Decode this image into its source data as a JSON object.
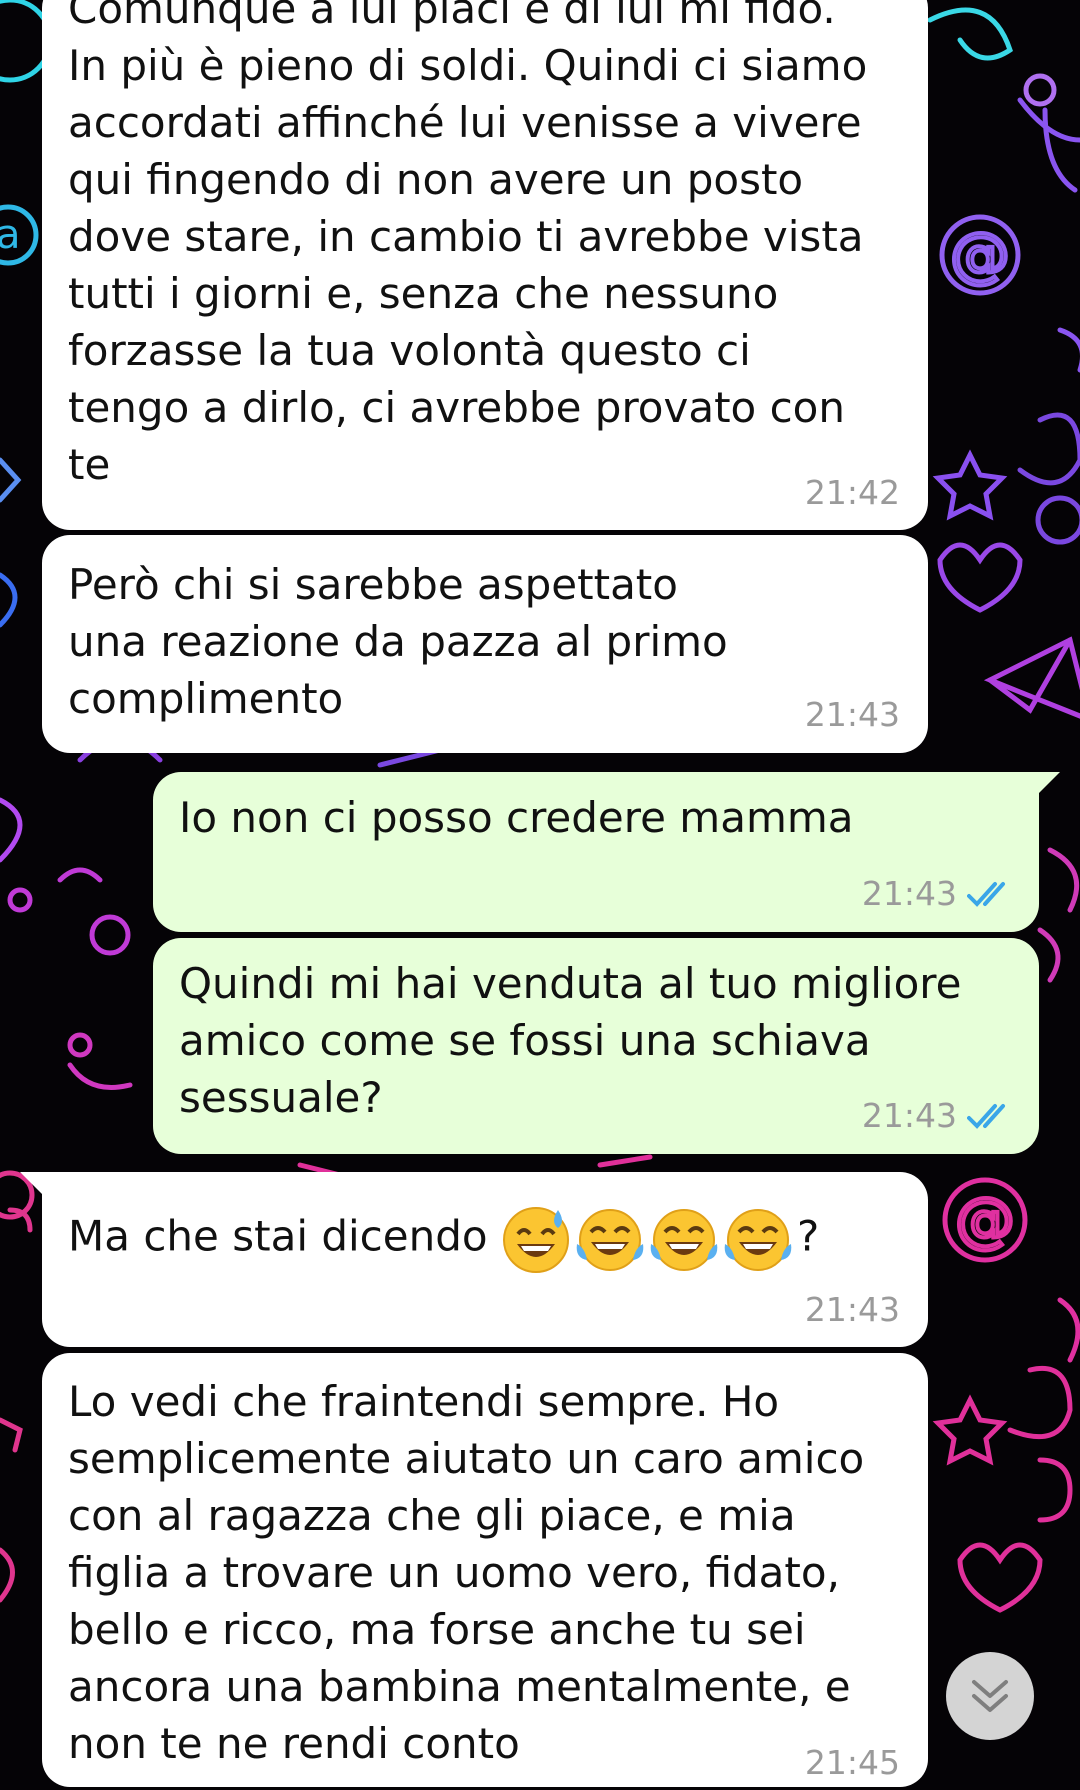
{
  "messages": [
    {
      "direction": "incoming",
      "text": "Comunque a lui piaci e di lui mi fido.\nIn più è pieno di soldi. Quindi ci siamo\naccordati affinché lui venisse a vivere\nqui fingendo di non avere un posto\ndove stare, in cambio ti avrebbe vista\ntutti i giorni e, senza che nessuno\nforzasse la tua volontà questo ci\ntengo a dirlo, ci avrebbe provato con\nte",
      "time": "21:42"
    },
    {
      "direction": "incoming",
      "text": "Però chi si sarebbe aspettato\nuna reazione da pazza al primo\ncomplimento",
      "time": "21:43"
    },
    {
      "direction": "outgoing",
      "text": "Io non ci posso credere mamma",
      "time": "21:43",
      "status": "read"
    },
    {
      "direction": "outgoing",
      "text": "Quindi mi hai venduta al tuo migliore\namico come se fossi una schiava\nsessuale?",
      "time": "21:43",
      "status": "read"
    },
    {
      "direction": "incoming",
      "text": "Ma che stai dicendo",
      "suffix": "?",
      "emojis": [
        "grinning-sweat-emoji",
        "tears-of-joy-emoji",
        "tears-of-joy-emoji",
        "tears-of-joy-emoji"
      ],
      "time": "21:43"
    },
    {
      "direction": "incoming",
      "text": "Lo vedi che fraintendi sempre. Ho\nsemplicemente aiutato un caro amico\ncon al ragazza che gli piace, e mia\nfiglia a trovare un uomo vero, fidato,\nbello e ricco, ma forse anche tu sei\nancora una bambina mentalmente, e\nnon te ne rendi conto",
      "time": "21:45"
    }
  ],
  "colors": {
    "incoming_bubble": "#ffffff",
    "outgoing_bubble": "#e7ffd9",
    "read_tick": "#3aa6e8",
    "timestamp": "#9a9a9a",
    "wallpaper": "#050306"
  },
  "icons": {
    "scroll_down": "double-chevron-down-icon",
    "read_status": "double-check-icon"
  }
}
